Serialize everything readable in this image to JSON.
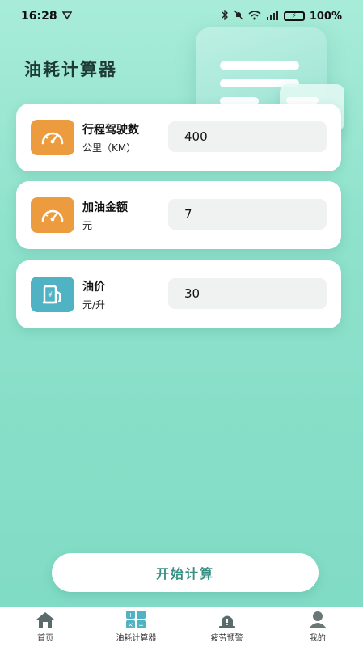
{
  "status_bar": {
    "time": "16:28",
    "battery": "100%"
  },
  "page": {
    "title": "油耗计算器"
  },
  "cards": [
    {
      "label": "行程驾驶数",
      "unit": "公里（KM）",
      "value": "400",
      "icon": "speedometer-icon"
    },
    {
      "label": "加油金额",
      "unit": "元",
      "value": "7",
      "icon": "speedometer-icon"
    },
    {
      "label": "油价",
      "unit": "元/升",
      "value": "30",
      "icon": "fuel-pump-icon"
    }
  ],
  "start_button": {
    "label": "开始计算"
  },
  "bottom_nav": [
    {
      "label": "首页",
      "icon": "home-icon"
    },
    {
      "label": "油耗计算器",
      "icon": "calculator-icon"
    },
    {
      "label": "疲劳预警",
      "icon": "alarm-icon"
    },
    {
      "label": "我的",
      "icon": "user-icon"
    }
  ],
  "colors": {
    "accent_orange": "#ec9c3f",
    "accent_teal": "#4fb3c4",
    "button_text": "#3a8f84"
  }
}
